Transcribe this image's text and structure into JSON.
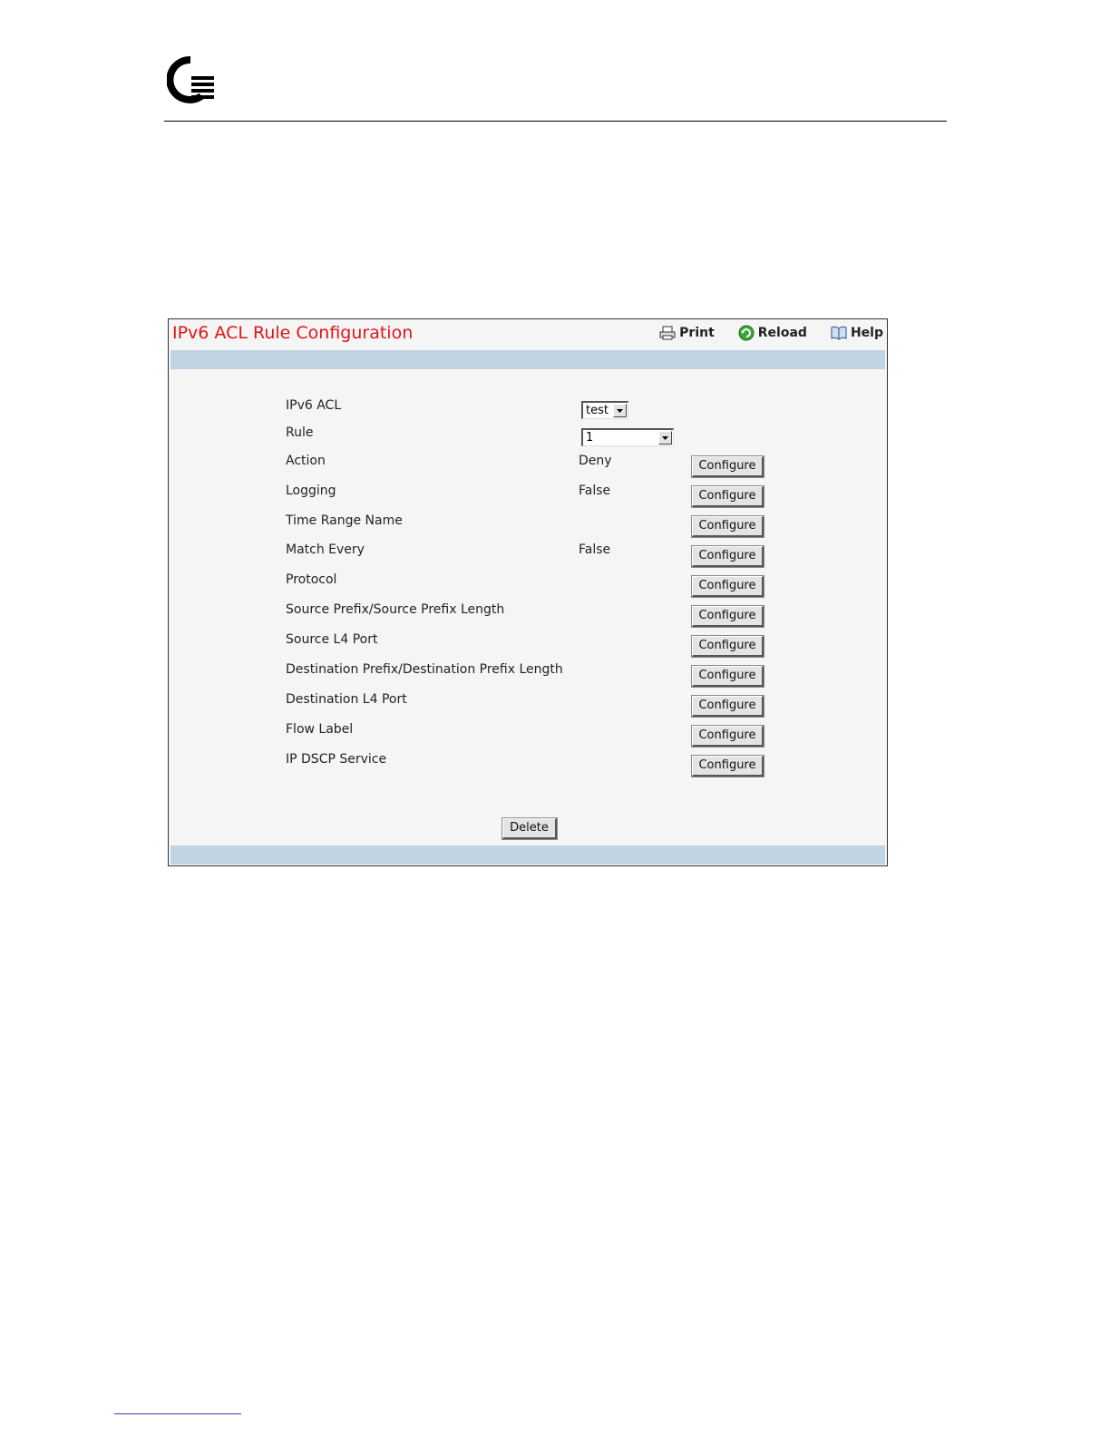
{
  "panel": {
    "title": "IPv6 ACL Rule Configuration",
    "toolbar": {
      "print_label": "Print",
      "reload_label": "Reload",
      "help_label": "Help"
    }
  },
  "form": {
    "ipv6_acl": {
      "label": "IPv6 ACL",
      "selected": "test"
    },
    "rule": {
      "label": "Rule",
      "selected": "1"
    },
    "rows": [
      {
        "label": "Action",
        "value": "Deny",
        "button": "Configure"
      },
      {
        "label": "Logging",
        "value": "False",
        "button": "Configure"
      },
      {
        "label": "Time Range Name",
        "value": "",
        "button": "Configure"
      },
      {
        "label": "Match Every",
        "value": "False",
        "button": "Configure"
      },
      {
        "label": "Protocol",
        "value": "",
        "button": "Configure"
      },
      {
        "label": "Source Prefix/Source Prefix Length",
        "value": "",
        "button": "Configure"
      },
      {
        "label": "Source L4 Port",
        "value": "",
        "button": "Configure"
      },
      {
        "label": "Destination Prefix/Destination Prefix Length",
        "value": "",
        "button": "Configure"
      },
      {
        "label": "Destination L4 Port",
        "value": "",
        "button": "Configure"
      },
      {
        "label": "Flow Label",
        "value": "",
        "button": "Configure"
      },
      {
        "label": "IP DSCP Service",
        "value": "",
        "button": "Configure"
      }
    ],
    "delete_label": "Delete"
  },
  "colors": {
    "title": "#e0141a",
    "band": "#bfd3e2",
    "panel_bg": "#f5f5f5"
  }
}
